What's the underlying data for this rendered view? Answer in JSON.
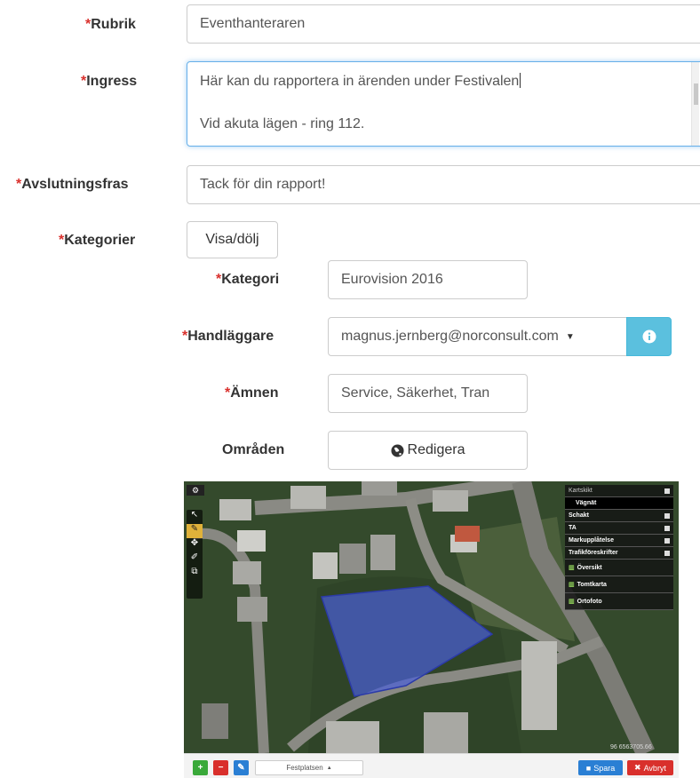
{
  "form": {
    "rubrik": {
      "label": "Rubrik",
      "value": "Eventhanteraren"
    },
    "ingress": {
      "label": "Ingress",
      "line1": "Här kan du rapportera in ärenden under Festivalen",
      "line2": "Vid akuta lägen - ring 112."
    },
    "avslutningsfras": {
      "label": "Avslutningsfras",
      "value": "Tack för din rapport!"
    },
    "kategorier": {
      "label": "Kategorier",
      "toggle_label": "Visa/dölj"
    },
    "kategori": {
      "label": "Kategori",
      "value": "Eurovision 2016"
    },
    "handlaggare": {
      "label": "Handläggare",
      "value": "magnus.jernberg@norconsult.com"
    },
    "amnen": {
      "label": "Ämnen",
      "value": "Service, Säkerhet, Tran"
    },
    "omraden": {
      "label": "Områden",
      "button_label": "Redigera"
    },
    "required_mark": "*"
  },
  "map": {
    "layer_panel": {
      "title": "Kartskikt",
      "group": "Vägnät",
      "layers": [
        "Schakt",
        "TA",
        "Markupplåtelse",
        "Trafikföreskrifter"
      ],
      "basemaps": [
        "Översikt",
        "Tomtkarta",
        "Ortofoto"
      ]
    },
    "coords": "96 6563705.66",
    "toolbar": {
      "add": "+",
      "remove": "−",
      "place_label": "Festplatsen",
      "save_label": "Spara",
      "cancel_label": "Avbryt"
    }
  },
  "colors": {
    "required": "#d9302c",
    "info": "#5bc0de",
    "save": "#2a7fd4",
    "cancel": "#d9302c",
    "add": "#3aa93a",
    "polygon": "#4a5fd9"
  }
}
